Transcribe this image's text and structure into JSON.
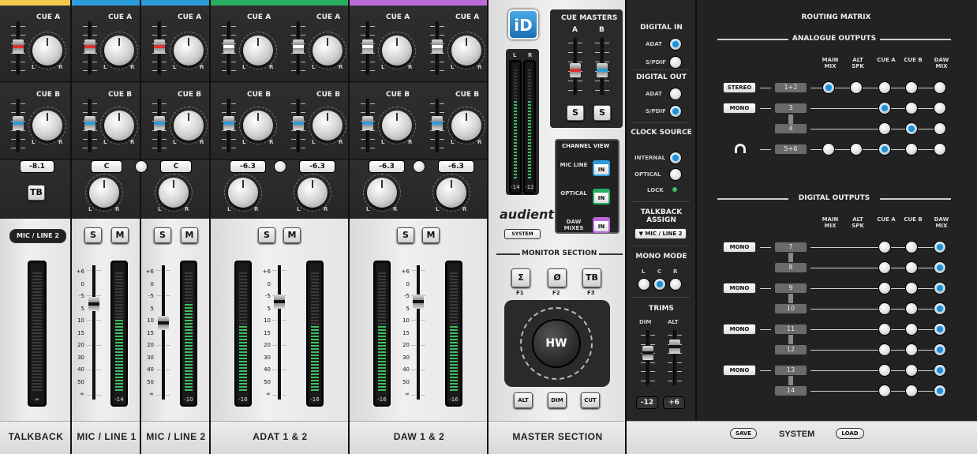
{
  "channels": [
    {
      "id": "talkback",
      "footer": "TALKBACK",
      "color": "#f2c94c",
      "type": "mono",
      "cue_a": "CUE A",
      "cue_b": "CUE B",
      "pan": "-8.1",
      "tb": "TB",
      "input": "MIC / LINE 2",
      "meter_label": "∞"
    },
    {
      "id": "mic1",
      "footer": "MIC / LINE 1",
      "color": "#2d9cdb",
      "type": "mono",
      "cue_a": "CUE A",
      "cue_b": "CUE B",
      "pan": "C",
      "solo": "S",
      "mute": "M",
      "meter_label": "-14"
    },
    {
      "id": "mic2",
      "footer": "MIC / LINE 2",
      "color": "#2d9cdb",
      "type": "mono",
      "cue_a": "CUE A",
      "cue_b": "CUE B",
      "pan": "C",
      "solo": "S",
      "mute": "M",
      "meter_label": "-10"
    },
    {
      "id": "adat",
      "footer": "ADAT 1 & 2",
      "color": "#27ae60",
      "type": "stereo",
      "cue_a": "CUE A",
      "cue_b": "CUE B",
      "pan_l": "-6.3",
      "pan_r": "-6.3",
      "solo": "S",
      "mute": "M",
      "meter_l": "-16",
      "meter_r": "-16"
    },
    {
      "id": "daw",
      "footer": "DAW 1 & 2",
      "color": "#bb6bd9",
      "type": "stereo",
      "cue_a": "CUE A",
      "cue_b": "CUE B",
      "pan_l": "-6.3",
      "pan_r": "-6.3",
      "solo": "S",
      "mute": "M",
      "meter_l": "-16",
      "meter_r": "-16"
    }
  ],
  "scale": [
    "+6",
    "0",
    "-5",
    "5",
    "10",
    "15",
    "20",
    "30",
    "40",
    "50",
    "∞"
  ],
  "pan_lr": {
    "l": "L",
    "r": "R"
  },
  "master": {
    "footer": "MASTER SECTION",
    "logo": "iD",
    "brand": "audient",
    "system_btn": "SYSTEM",
    "meter_l": "-14",
    "meter_r": "-12",
    "meter_top_l": "L",
    "meter_top_r": "R",
    "cue_masters": "CUE MASTERS",
    "cue_a": "A",
    "cue_b": "B",
    "solo": "S",
    "channel_view": "CHANNEL VIEW",
    "cv": [
      {
        "label": "MIC LINE",
        "btn": "IN",
        "color": "#2d9cdb"
      },
      {
        "label": "OPTICAL",
        "btn": "IN",
        "color": "#27ae60"
      },
      {
        "label": "DAW MIXES",
        "btn": "IN",
        "color": "#bb6bd9"
      }
    ],
    "monitor": "MONITOR SECTION",
    "f1": "F1",
    "f2": "F2",
    "f3": "F3",
    "sum": "Σ",
    "phase": "Ø",
    "tb": "TB",
    "hw": "HW",
    "alt": "ALT",
    "dim": "DIM",
    "cut": "CUT"
  },
  "settings": {
    "digital_in": "DIGITAL IN",
    "adat": "ADAT",
    "spdif": "S/PDIF",
    "digital_out": "DIGITAL OUT",
    "clock": "CLOCK SOURCE",
    "internal": "INTERNAL",
    "optical": "OPTICAL",
    "lock": "LOCK",
    "talkback_assign": "TALKBACK ASSIGN",
    "tb_source": "▼ MIC / LINE 2",
    "mono_mode": "MONO MODE",
    "l": "L",
    "c": "C",
    "r": "R",
    "trims": "TRIMS",
    "dim": "DIM",
    "alt": "ALT",
    "dim_val": "-12",
    "alt_val": "+6"
  },
  "routing": {
    "title": "ROUTING MATRIX",
    "analogue": "ANALOGUE OUTPUTS",
    "digital": "DIGITAL OUTPUTS",
    "cols": [
      "MAIN MIX",
      "ALT SPK",
      "CUE A",
      "CUE B",
      "DAW MIX"
    ],
    "analogue_rows": [
      {
        "mode": "STEREO",
        "ch": "1+2",
        "on": [
          0
        ],
        "dots": [
          0,
          1,
          2,
          3,
          4
        ]
      },
      {
        "mode": "MONO",
        "ch": "3",
        "on": [
          2
        ],
        "dots": [
          2,
          3,
          4
        ]
      },
      {
        "mode": "",
        "ch": "4",
        "on": [
          3
        ],
        "dots": [
          2,
          3,
          4
        ]
      },
      {
        "mode": "headphone-icon",
        "ch": "5+6",
        "on": [
          2
        ],
        "dots": [
          0,
          1,
          2,
          3,
          4
        ]
      }
    ],
    "digital_rows": [
      {
        "mode": "MONO",
        "ch": "7"
      },
      {
        "mode": "",
        "ch": "8"
      },
      {
        "mode": "MONO",
        "ch": "9"
      },
      {
        "mode": "",
        "ch": "10"
      },
      {
        "mode": "MONO",
        "ch": "11"
      },
      {
        "mode": "",
        "ch": "12"
      },
      {
        "mode": "MONO",
        "ch": "13"
      },
      {
        "mode": "",
        "ch": "14"
      }
    ],
    "save": "SAVE",
    "system": "SYSTEM",
    "load": "LOAD"
  }
}
